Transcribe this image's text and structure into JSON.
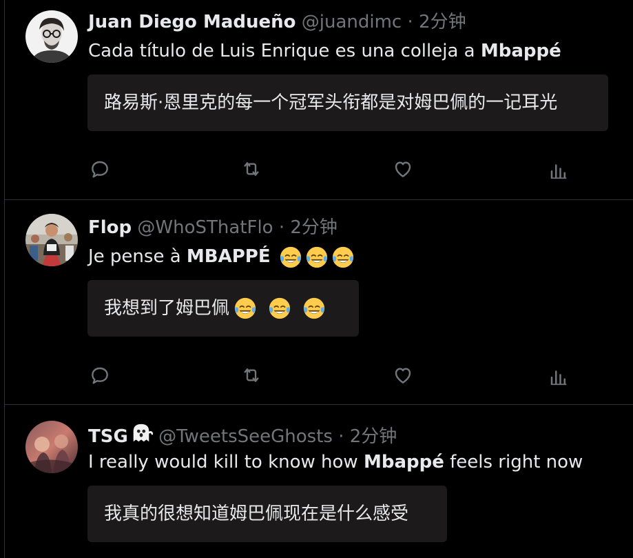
{
  "tweets": [
    {
      "name": "Juan Diego Madueño",
      "handle": "@juandimc",
      "separator": "·",
      "time": "2分钟",
      "text_before": "Cada título de Luis Enrique es una colleja a ",
      "text_bold": "Mbappé",
      "text_after": "",
      "translation": "路易斯·恩里克的每一个冠军头衔都是对姆巴佩的一记耳光",
      "avatar_icon": "person-with-glasses-avatar"
    },
    {
      "name": "Flop",
      "handle": "@WhoSThatFlo",
      "separator": "·",
      "time": "2分钟",
      "text_before": "Je pense à ",
      "text_bold": "MBAPPÉ",
      "text_after": "",
      "emoji": "tears-of-joy-emoji",
      "emoji_count": 3,
      "translation": "我想到了姆巴佩",
      "avatar_icon": "runner-photo-avatar"
    },
    {
      "name": "TSG",
      "name_icon": "ghost-icon",
      "handle": "@TweetsSeeGhosts",
      "separator": "·",
      "time": "2分钟",
      "text_before": "I really would kill to know how ",
      "text_bold": "Mbappé",
      "text_after": " feels right now",
      "translation": "我真的很想知道姆巴佩现在是什么感受",
      "avatar_icon": "artwork-avatar"
    }
  ],
  "actions": [
    "reply-icon",
    "retweet-icon",
    "like-icon",
    "views-icon"
  ],
  "colors": {
    "background": "#000000",
    "text": "#e7e9ea",
    "secondary": "#71767b",
    "divider": "#2f3336",
    "translation_bg": "#1c1a1a"
  }
}
